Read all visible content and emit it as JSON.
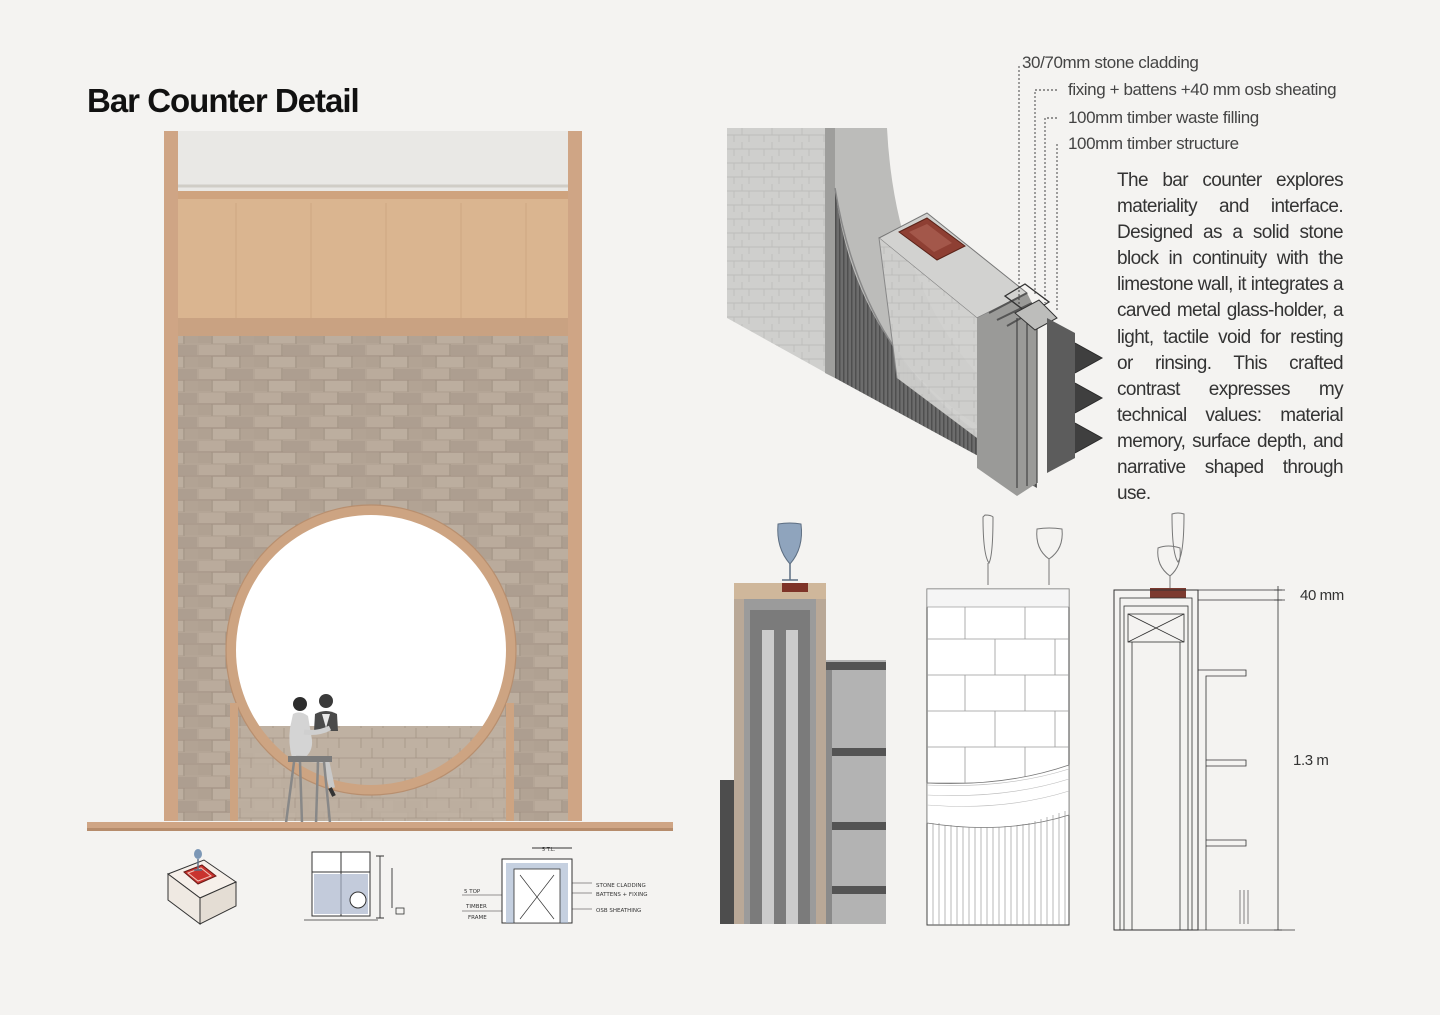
{
  "title": "Bar Counter Detail",
  "layers": [
    "30/70mm stone cladding",
    "fixing + battens +40 mm osb sheating",
    "100mm timber waste filling",
    "100mm timber structure"
  ],
  "description": "The bar counter explores materiality and interface. Designed as a solid stone block in continuity with the limestone wall, it integrates a carved metal glass-holder, a light, tactile void for resting or rinsing. This crafted contrast expresses my technical values: material memory, surface depth, and narrative shaped through use.",
  "dimensions": {
    "top": "40 mm",
    "height": "1.3 m"
  },
  "sketch_labels": {
    "left_top": "5 TOP",
    "left_mid": "TIMBER",
    "left_bot": "FRAME",
    "right_top": "STONE CLADDING",
    "right_mid": "BATTENS + FIXING",
    "right_bot": "OSB SHEATHING",
    "top": "5 T.L."
  },
  "colors": {
    "stone": "#b8aa9b",
    "timber": "#d9b48e",
    "frame": "#cda483",
    "metal": "#8a3a2e",
    "dark_stone": "#5c5c5c"
  }
}
